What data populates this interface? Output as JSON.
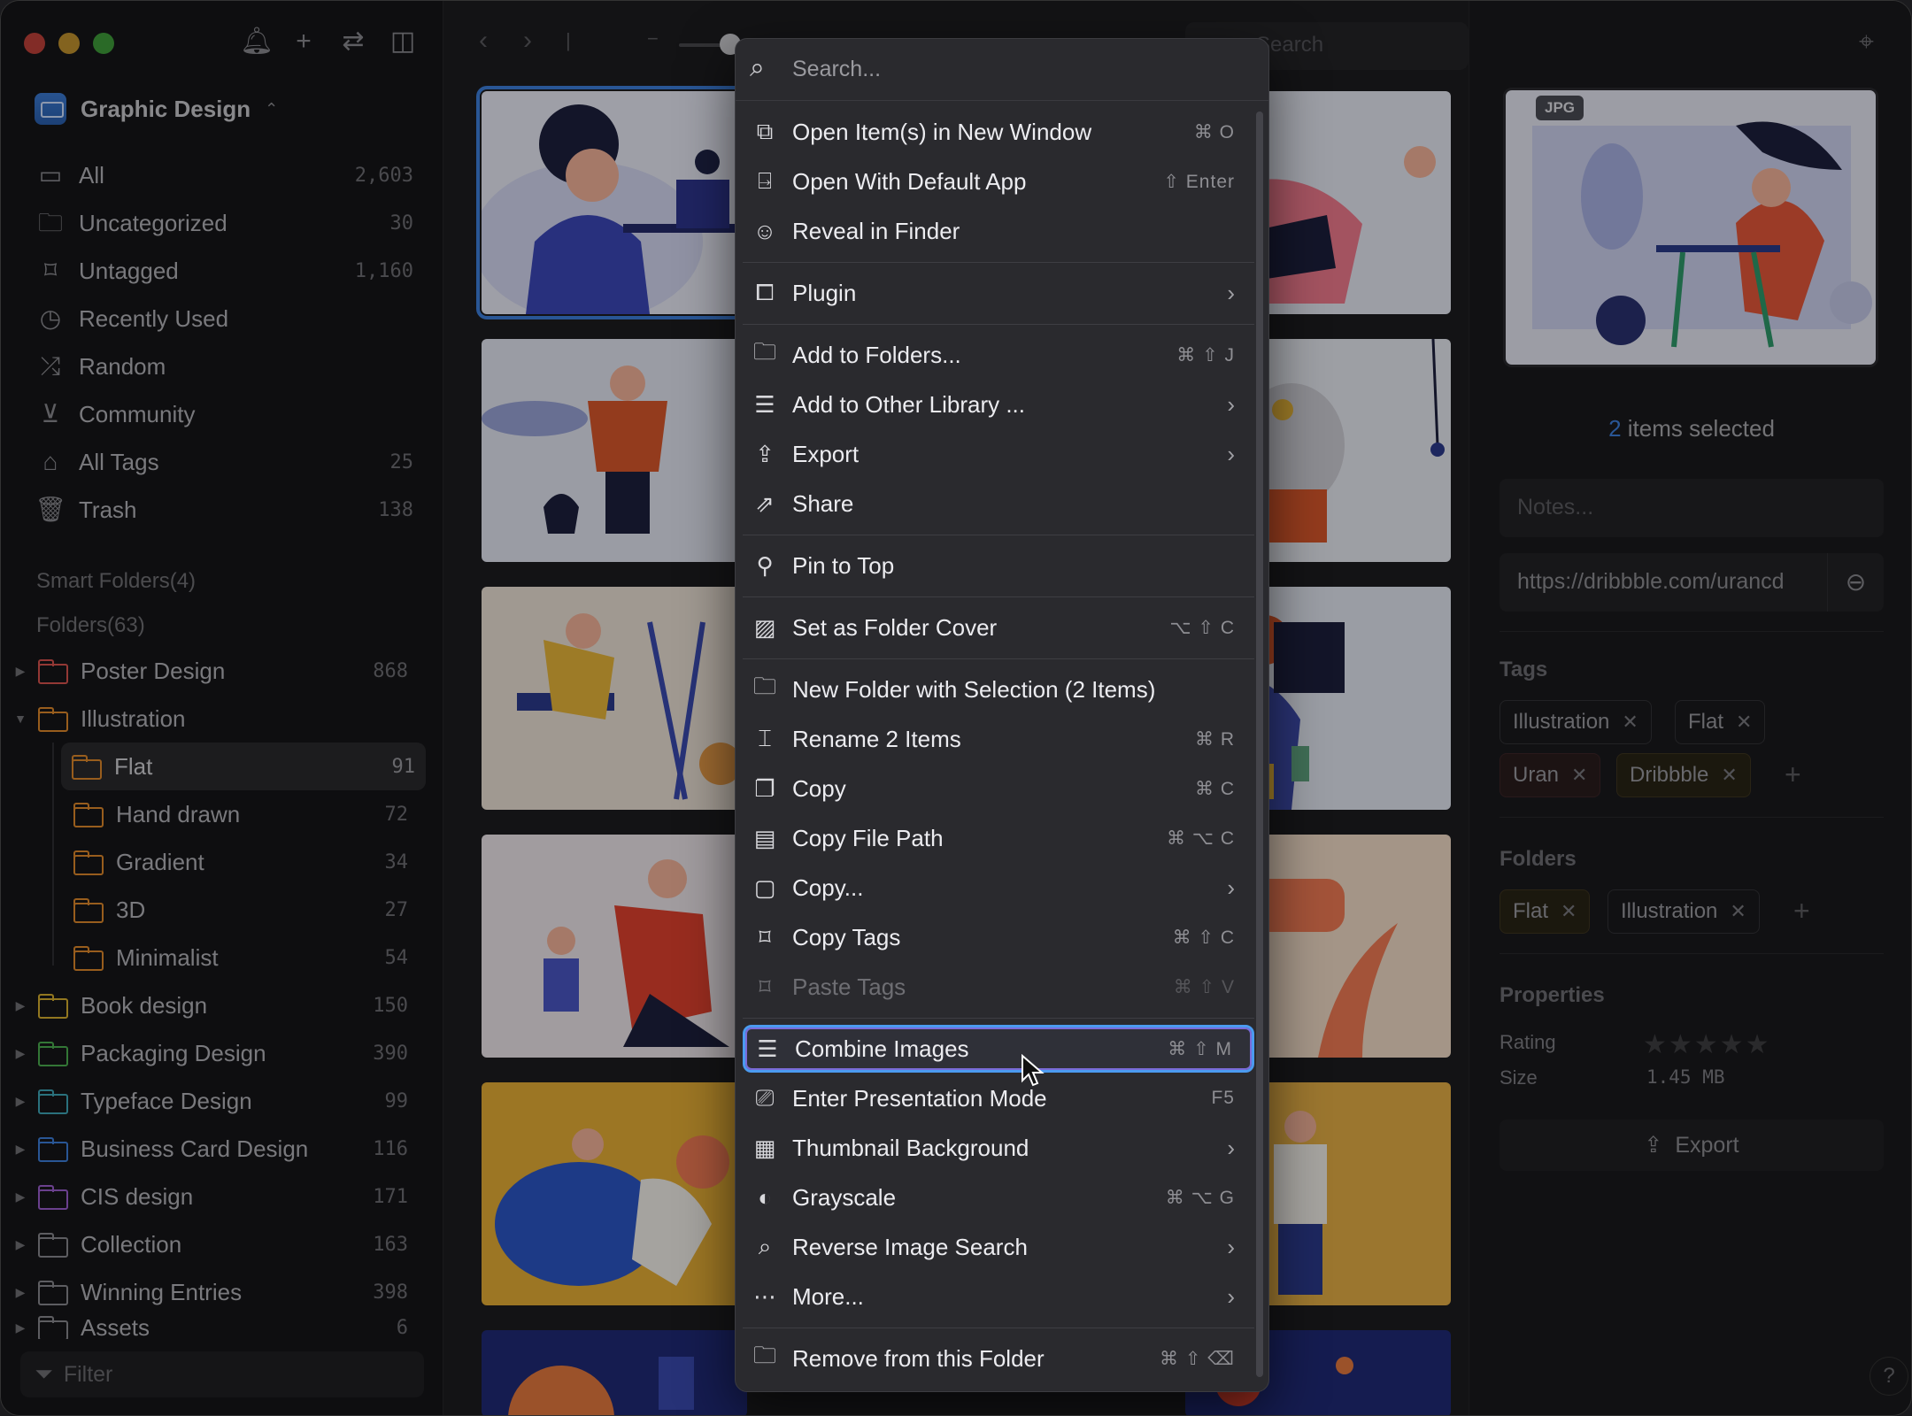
{
  "sidebar": {
    "library_name": "Graphic Design",
    "nav": [
      {
        "label": "All",
        "count": "2,603",
        "icon": "inbox-icon"
      },
      {
        "label": "Uncategorized",
        "count": "30",
        "icon": "folder-question-icon"
      },
      {
        "label": "Untagged",
        "count": "1,160",
        "icon": "tag-question-icon"
      },
      {
        "label": "Recently Used",
        "count": "",
        "icon": "clock-icon"
      },
      {
        "label": "Random",
        "count": "",
        "icon": "shuffle-icon"
      },
      {
        "label": "Community",
        "count": "",
        "icon": "download-box-icon"
      },
      {
        "label": "All Tags",
        "count": "25",
        "icon": "bookmark-icon"
      },
      {
        "label": "Trash",
        "count": "138",
        "icon": "trash-icon"
      }
    ],
    "smart_folders": "Smart Folders(4)",
    "folders_head": "Folders(63)",
    "folders": [
      {
        "label": "Poster Design",
        "count": "868",
        "color": "#d9534f"
      },
      {
        "label": "Illustration",
        "count": "",
        "color": "#e08a2c"
      },
      {
        "label": "Flat",
        "count": "91",
        "color": "#e08a2c"
      },
      {
        "label": "Hand drawn",
        "count": "72",
        "color": "#e08a2c"
      },
      {
        "label": "Gradient",
        "count": "34",
        "color": "#e08a2c"
      },
      {
        "label": "3D",
        "count": "27",
        "color": "#e08a2c"
      },
      {
        "label": "Minimalist",
        "count": "54",
        "color": "#e08a2c"
      },
      {
        "label": "Book design",
        "count": "150",
        "color": "#d8b030"
      },
      {
        "label": "Packaging Design",
        "count": "390",
        "color": "#4caf50"
      },
      {
        "label": "Typeface Design",
        "count": "99",
        "color": "#3fa7b8"
      },
      {
        "label": "Business Card Design",
        "count": "116",
        "color": "#3d7fdc"
      },
      {
        "label": "CIS design",
        "count": "171",
        "color": "#9c5fd0"
      },
      {
        "label": "Collection",
        "count": "163",
        "color": "#8a8a8f"
      },
      {
        "label": "Winning Entries",
        "count": "398",
        "color": "#8a8a8f"
      },
      {
        "label": "Assets",
        "count": "6",
        "color": "#8a8a8f"
      }
    ],
    "filter_placeholder": "Filter"
  },
  "toolbar": {
    "search_placeholder": "Search"
  },
  "menu": {
    "search_placeholder": "Search...",
    "items": [
      {
        "label": "Open Item(s) in New Window",
        "shortcut": "⌘ O",
        "icon": "new-window-icon"
      },
      {
        "label": "Open With Default App",
        "shortcut": "⇧ Enter",
        "icon": "open-app-icon"
      },
      {
        "label": "Reveal in Finder",
        "shortcut": "",
        "icon": "finder-icon"
      },
      {
        "label": "Plugin",
        "shortcut": "",
        "icon": "puzzle-icon",
        "submenu": true
      },
      {
        "label": "Add to Folders...",
        "shortcut": "⌘ ⇧ J",
        "icon": "add-folder-icon"
      },
      {
        "label": "Add to Other Library ...",
        "shortcut": "",
        "icon": "library-icon",
        "submenu": true
      },
      {
        "label": "Export",
        "shortcut": "",
        "icon": "export-icon",
        "submenu": true
      },
      {
        "label": "Share",
        "shortcut": "",
        "icon": "share-icon"
      },
      {
        "label": "Pin to Top",
        "shortcut": "",
        "icon": "pin-icon"
      },
      {
        "label": "Set as Folder Cover",
        "shortcut": "⌥ ⇧ C",
        "icon": "image-icon"
      },
      {
        "label": "New Folder with Selection (2 Items)",
        "shortcut": "",
        "icon": "folder-plus-icon"
      },
      {
        "label": "Rename 2 Items",
        "shortcut": "⌘ R",
        "icon": "rename-icon"
      },
      {
        "label": "Copy",
        "shortcut": "⌘ C",
        "icon": "copy-icon"
      },
      {
        "label": "Copy File Path",
        "shortcut": "⌘ ⌥ C",
        "icon": "terminal-icon"
      },
      {
        "label": "Copy...",
        "shortcut": "",
        "icon": "copy-more-icon",
        "submenu": true
      },
      {
        "label": "Copy Tags",
        "shortcut": "⌘ ⇧ C",
        "icon": "copy-tags-icon"
      },
      {
        "label": "Paste Tags",
        "shortcut": "⌘ ⇧ V",
        "icon": "paste-tags-icon",
        "disabled": true
      },
      {
        "label": "Combine Images",
        "shortcut": "⌘ ⇧ M",
        "icon": "combine-icon",
        "highlighted": true
      },
      {
        "label": "Enter Presentation Mode",
        "shortcut": "F5",
        "icon": "presentation-icon"
      },
      {
        "label": "Thumbnail Background",
        "shortcut": "",
        "icon": "checker-icon",
        "submenu": true
      },
      {
        "label": "Grayscale",
        "shortcut": "⌘ ⌥ G",
        "icon": "grayscale-icon"
      },
      {
        "label": "Reverse Image Search",
        "shortcut": "",
        "icon": "image-search-icon",
        "submenu": true
      },
      {
        "label": "More...",
        "shortcut": "",
        "icon": "ellipsis-icon",
        "submenu": true
      },
      {
        "label": "Remove from this Folder",
        "shortcut": "⌘ ⇧ ⌫",
        "icon": "remove-folder-icon"
      }
    ]
  },
  "inspector": {
    "badge": "JPG",
    "selected_count": "2",
    "selected_text": " items selected",
    "notes_placeholder": "Notes...",
    "url": "https://dribbble.com/urancd",
    "tags_head": "Tags",
    "tags": [
      "Illustration",
      "Flat",
      "Uran",
      "Dribbble"
    ],
    "folders_head": "Folders",
    "folders": [
      "Flat",
      "Illustration"
    ],
    "properties_head": "Properties",
    "rating_label": "Rating",
    "rating_stars": "★★★★★",
    "size_label": "Size",
    "size_value": "1.45 MB",
    "export_label": "Export",
    "help": "?"
  },
  "colors": {
    "accent": "#3d7fdc",
    "highlight_border": "#4b9bf0"
  }
}
